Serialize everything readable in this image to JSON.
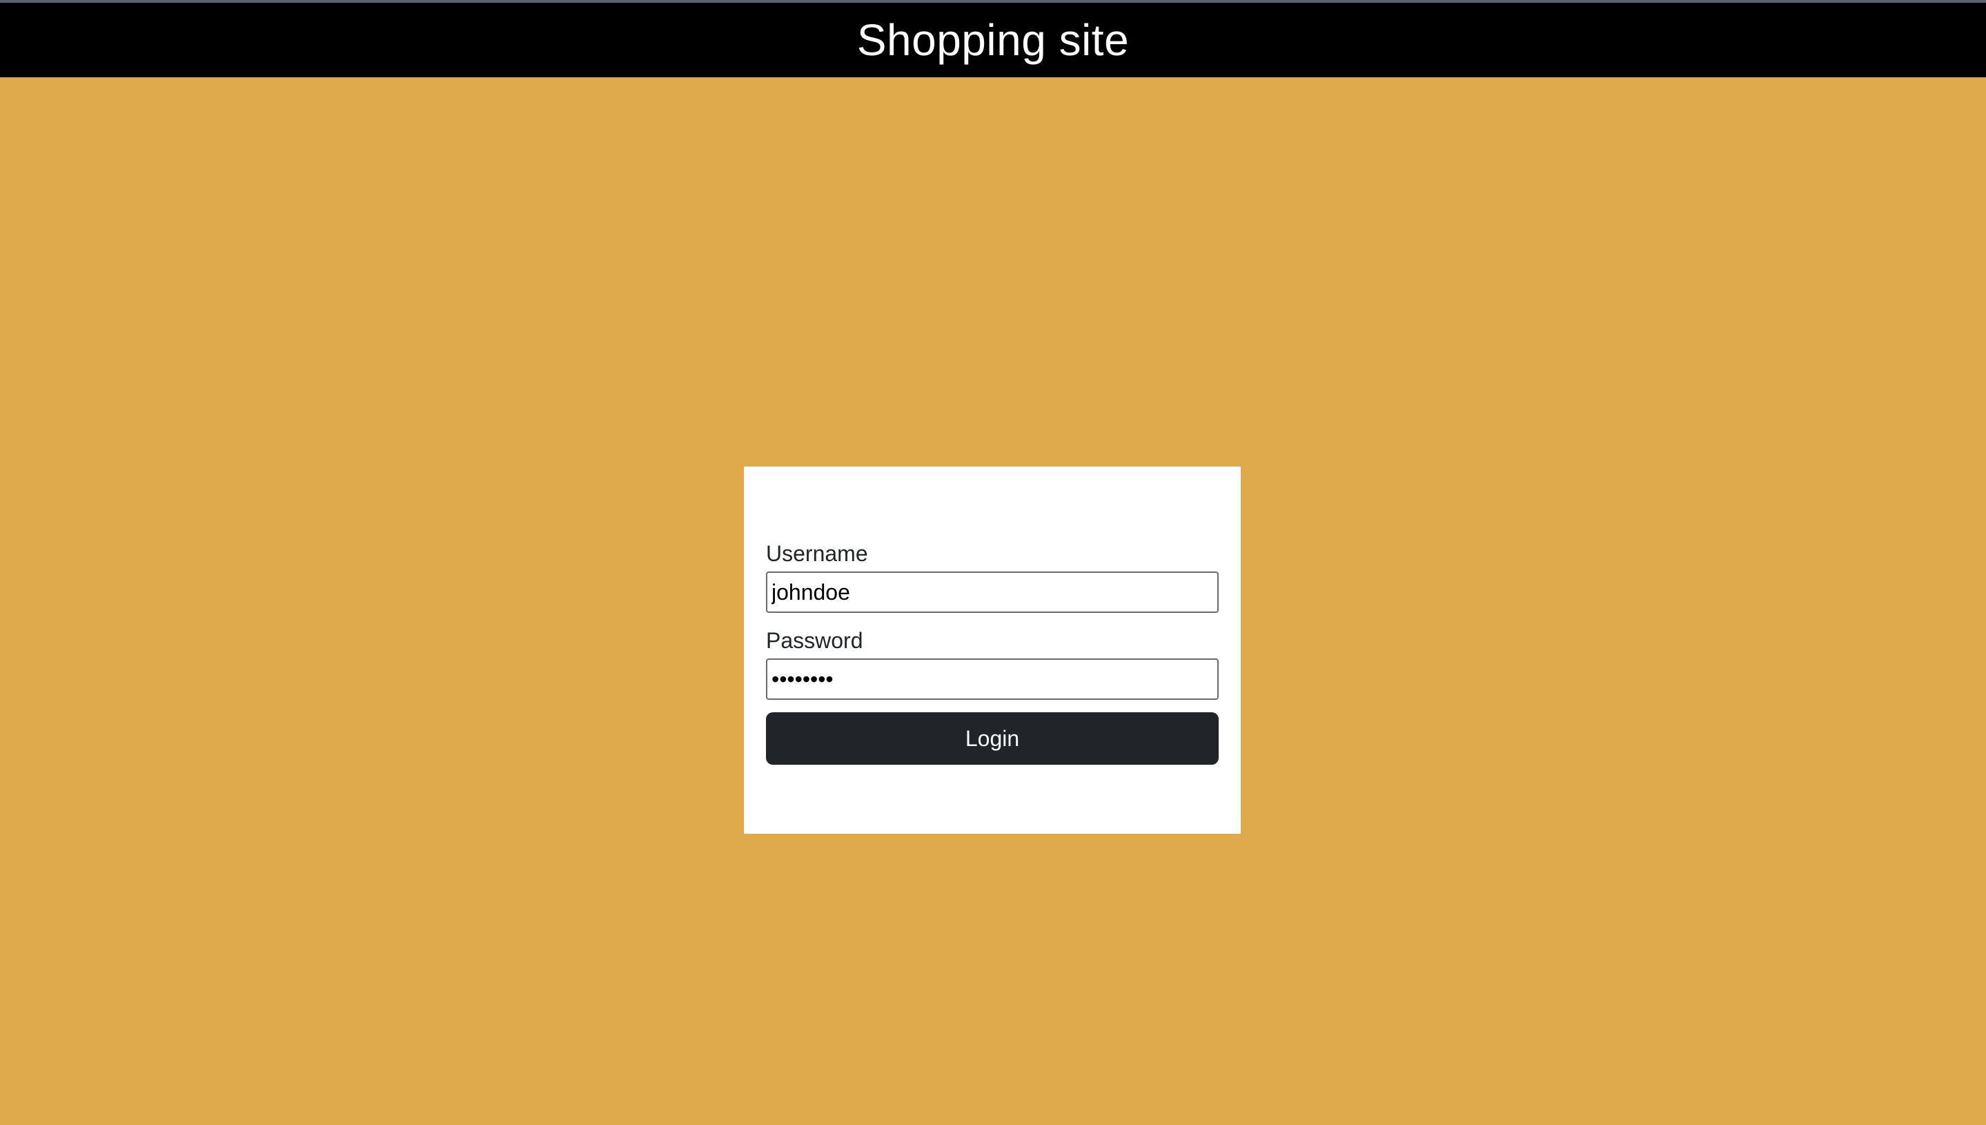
{
  "header": {
    "title": "Shopping site"
  },
  "login_form": {
    "username_label": "Username",
    "username_value": "johndoe",
    "password_label": "Password",
    "password_value": "password",
    "login_label": "Login"
  },
  "colors": {
    "page_background": "#dfaa4c",
    "header_background": "#000000",
    "card_background": "#ffffff",
    "button_background": "#212529"
  }
}
